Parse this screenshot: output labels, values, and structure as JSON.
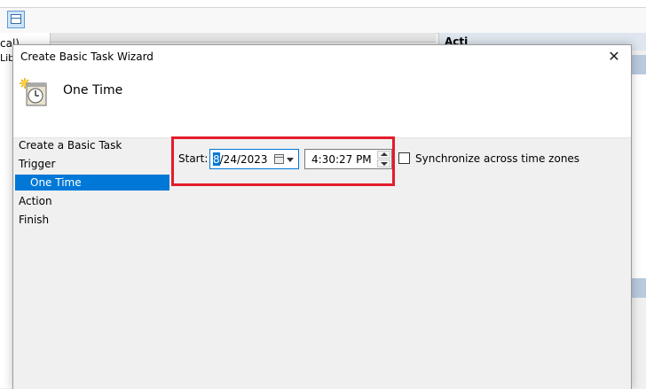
{
  "background": {
    "tree_text_1": "cal)",
    "tree_text_2": "Lib",
    "actions_header": "Acti"
  },
  "dialog": {
    "title": "Create Basic Task Wizard",
    "close_glyph": "✕",
    "header": {
      "icon": "calendar-clock-icon",
      "title": "One Time"
    },
    "nav": {
      "items": [
        {
          "label": "Create a Basic Task"
        },
        {
          "label": "Trigger"
        },
        {
          "label": "One Time",
          "selected": true
        },
        {
          "label": "Action"
        },
        {
          "label": "Finish"
        }
      ]
    },
    "form": {
      "start_label": "Start:",
      "date_first": "8",
      "date_rest": "/24/2023",
      "time_value": "4:30:27 PM",
      "sync_label": "Synchronize across time zones",
      "sync_checked": false
    }
  },
  "colors": {
    "selection": "#0078d7",
    "highlight_box": "#e31c2b"
  }
}
